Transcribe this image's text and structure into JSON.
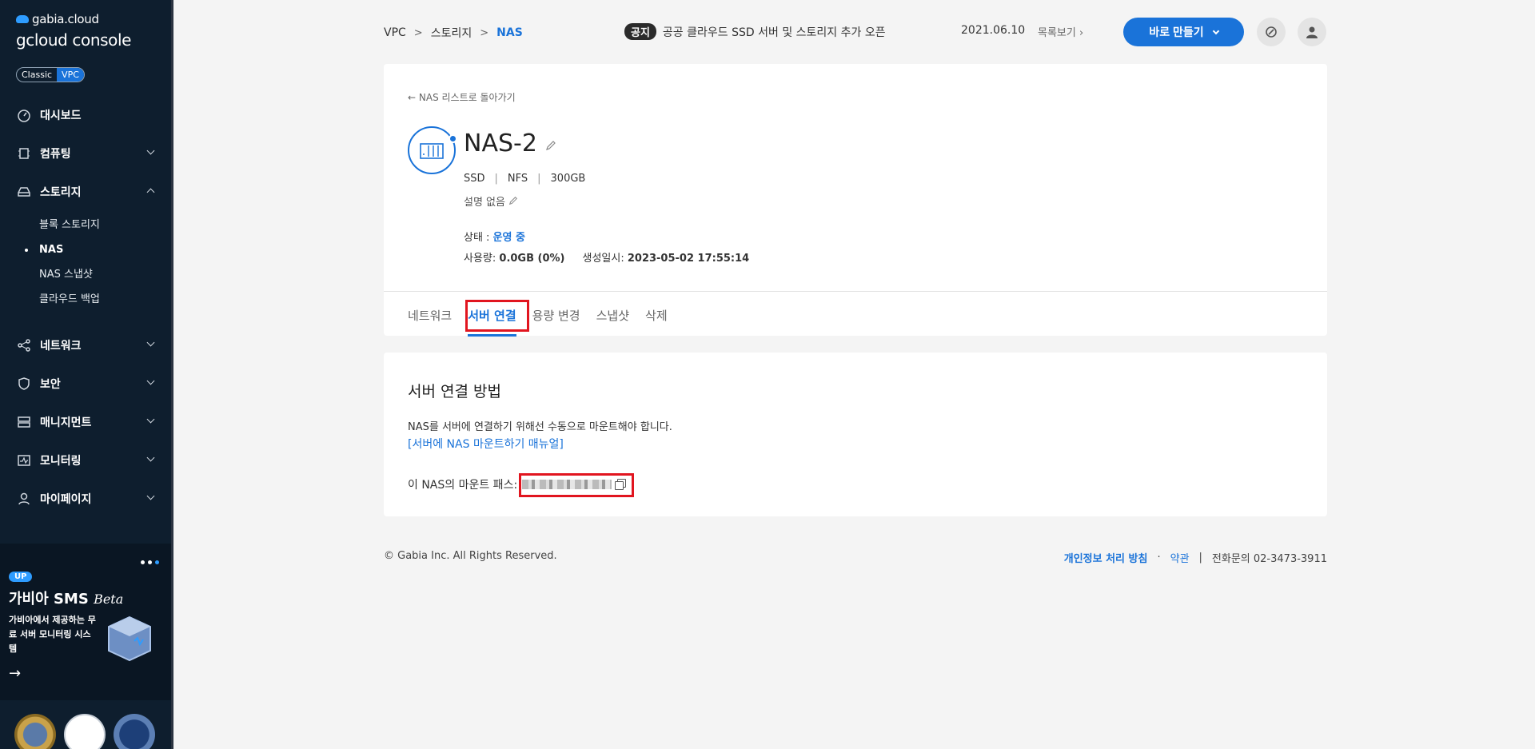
{
  "sidebar": {
    "brand_top": "gabia.cloud",
    "brand_main": "gcloud console",
    "toggle": [
      "Classic",
      "VPC"
    ],
    "items": [
      {
        "label": "대시보드"
      },
      {
        "label": "컴퓨팅"
      },
      {
        "label": "스토리지"
      },
      {
        "label": "네트워크"
      },
      {
        "label": "보안"
      },
      {
        "label": "매니지먼트"
      },
      {
        "label": "모니터링"
      },
      {
        "label": "마이페이지"
      }
    ],
    "storage_sub": [
      "블록 스토리지",
      "NAS",
      "NAS 스냅샷",
      "클라우드 백업"
    ],
    "promo": {
      "badge": "UP",
      "title": "가비아 SMS",
      "title_em": "Beta",
      "desc": "가비아에서 제공하는 무료 서버 모니터링 시스템"
    }
  },
  "header": {
    "breadcrumb": [
      "VPC",
      "스토리지",
      "NAS"
    ],
    "notice_tag": "공지",
    "notice_text": "공공 클라우드 SSD 서버 및 스토리지 추가 오픈",
    "notice_date": "2021.06.10",
    "notice_more": "목록보기",
    "create_label": "바로 만들기"
  },
  "detail": {
    "back": "NAS 리스트로 돌아가기",
    "name": "NAS-2",
    "specs": [
      "SSD",
      "NFS",
      "300GB"
    ],
    "description": "설명 없음",
    "status_label": "상태 : ",
    "status_value": "운영 중",
    "usage_label": "사용량: ",
    "usage_value": "0.0GB (0%)",
    "created_label": "생성일시: ",
    "created_value": "2023-05-02 17:55:14",
    "tabs": [
      "네트워크",
      "서버 연결",
      "용량 변경",
      "스냅샷",
      "삭제"
    ]
  },
  "connect": {
    "title": "서버 연결 방법",
    "text": "NAS를 서버에 연결하기 위해선 수동으로 마운트해야 합니다.",
    "link": "[서버에 NAS 마운트하기 매뉴얼]",
    "mount_label": "이 NAS의 마운트 패스:"
  },
  "footer": {
    "copyright": "© Gabia Inc. All Rights Reserved.",
    "privacy": "개인정보 처리 방침",
    "terms": "약관",
    "contact": "전화문의  02-3473-3911"
  }
}
